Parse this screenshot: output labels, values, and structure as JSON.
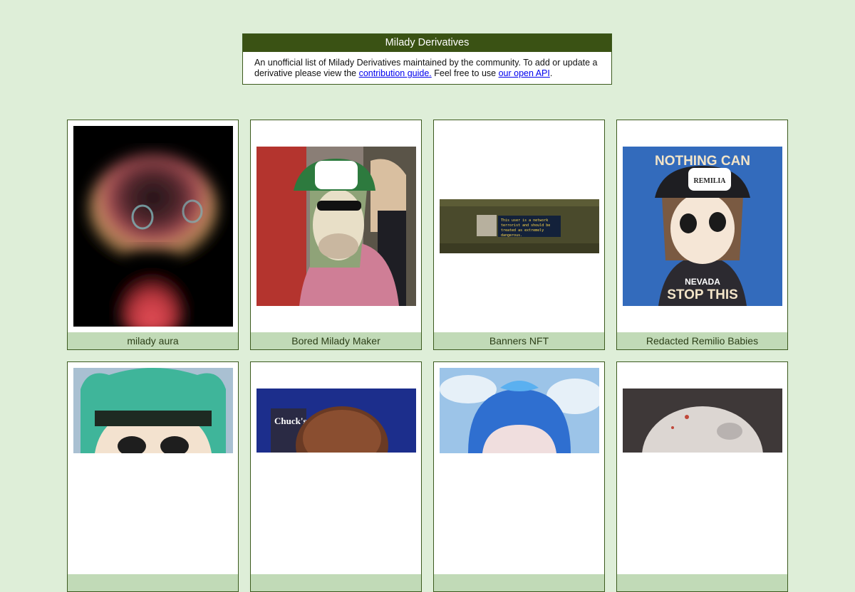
{
  "header": {
    "title": "Milady Derivatives",
    "text_before_link1": "An unofficial list of Milady Derivatives maintained by the community. To add or update a derivative please view the ",
    "link1": "contribution guide.",
    "text_between_links": " Feel free to use ",
    "link2": "our open API",
    "text_after_link2": "."
  },
  "cards": [
    {
      "name": "milady aura"
    },
    {
      "name": "Bored Milady Maker"
    },
    {
      "name": "Banners NFT",
      "image_text": [
        "This user is a network",
        "terrorist and should be",
        "treated as extremely",
        "dangerous."
      ]
    },
    {
      "name": "Redacted Remilio Babies",
      "image_text": [
        "NOTHING CAN",
        "REMILIA",
        "NEVADA",
        "STOP THIS"
      ]
    },
    {
      "name": ""
    },
    {
      "name": "",
      "image_text": [
        "Chuck's"
      ]
    },
    {
      "name": ""
    },
    {
      "name": ""
    }
  ],
  "colors": {
    "background": "#deeed8",
    "header_bg": "#3a5214",
    "caption_bg": "#c1dab7",
    "border": "#3c5a1e",
    "link": "#0000ee"
  }
}
